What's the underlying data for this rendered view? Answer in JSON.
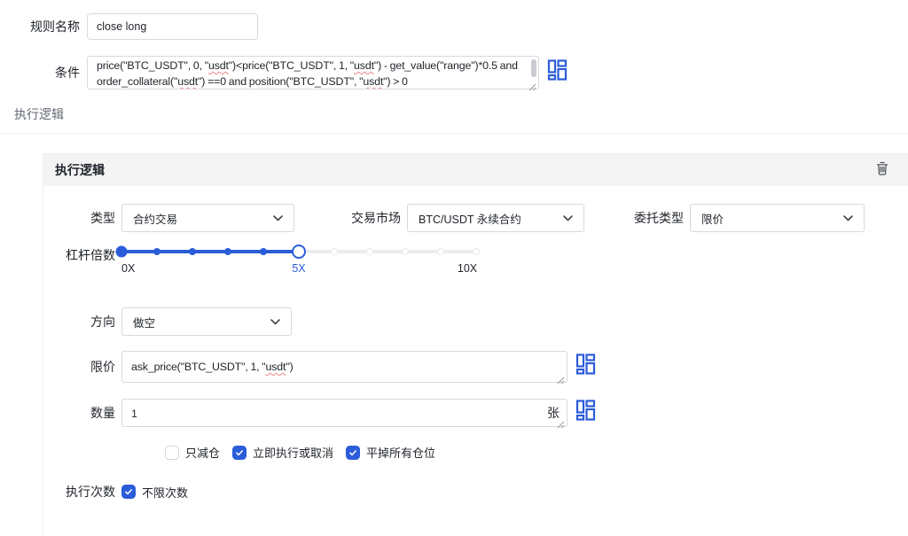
{
  "colors": {
    "accent": "#2b5cd9",
    "header_bg": "#f4f4f5",
    "border": "#d8d9dd",
    "text": "#1f2329",
    "muted": "#646a73",
    "misspell_underline": "#f08686"
  },
  "spellcheck_words": [
    "usdt"
  ],
  "icons": {
    "expression_editor": "blocks-icon",
    "delete": "trash-icon",
    "dropdown": "chevron-down-icon",
    "resize": "resize-grip-icon"
  },
  "form_top": {
    "rule_name": {
      "label": "规则名称",
      "value": "close long"
    },
    "condition": {
      "label": "条件",
      "value": "price(\"BTC_USDT\", 0, \"usdt\")<price(\"BTC_USDT\", 1, \"usdt\") - get_value(\"range\")*0.5 and order_collateral(\"usdt\") ==0 and position(\"BTC_USDT\", \"usdt\") > 0"
    }
  },
  "section_label": "执行逻辑",
  "card": {
    "title": "执行逻辑",
    "fields": {
      "type": {
        "label": "类型",
        "value": "合约交易"
      },
      "market": {
        "label": "交易市场",
        "value": "BTC/USDT 永续合约"
      },
      "order_type": {
        "label": "委托类型",
        "value": "限价"
      },
      "leverage": {
        "label": "杠杆倍数",
        "min": 0,
        "max": 10,
        "value": 5,
        "min_label": "0X",
        "current_label": "5X",
        "max_label": "10X"
      },
      "direction": {
        "label": "方向",
        "value": "做空"
      },
      "limit_price": {
        "label": "限价",
        "value": "ask_price(\"BTC_USDT\", 1, \"usdt\")"
      },
      "quantity": {
        "label": "数量",
        "value": "1",
        "unit": "张"
      },
      "checkboxes": [
        {
          "label": "只减仓",
          "checked": false
        },
        {
          "label": "立即执行或取消",
          "checked": true
        },
        {
          "label": "平掉所有仓位",
          "checked": true
        }
      ],
      "exec_count": {
        "label": "执行次数",
        "option": {
          "label": "不限次数",
          "checked": true
        }
      }
    }
  }
}
